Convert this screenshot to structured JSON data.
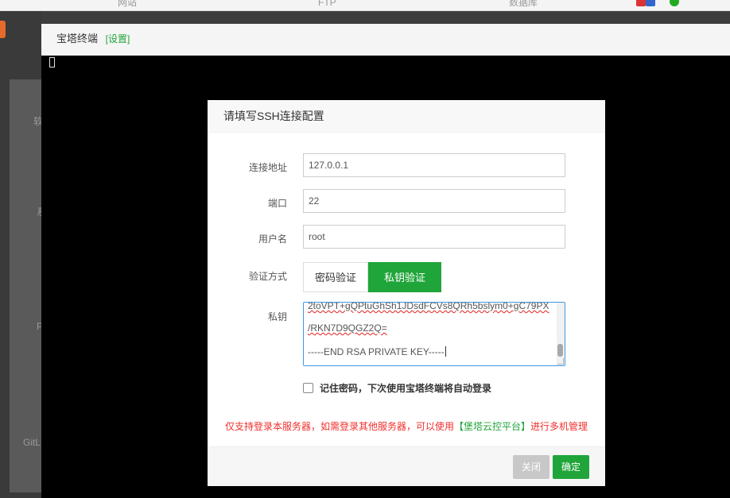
{
  "background": {
    "top_tabs": [
      "网站",
      "FTP",
      "数据库"
    ],
    "side_labels": [
      "软",
      "系",
      "P",
      "GitL"
    ]
  },
  "terminal": {
    "title": "宝塔终端",
    "settings_link": "[设置]"
  },
  "dialog": {
    "title": "请填写SSH连接配置",
    "host_label": "连接地址",
    "host_value": "127.0.0.1",
    "port_label": "端口",
    "port_value": "22",
    "user_label": "用户名",
    "user_value": "root",
    "auth_label": "验证方式",
    "auth_password": "密码验证",
    "auth_key": "私钥验证",
    "key_label": "私钥",
    "key_line1": "2toVPT+gQPtuGhSh1JDsdFCVs8QRh5bslym0+gC79PX",
    "key_line2": "/RKN7D9QGZ2Q=",
    "key_line3": "-----END RSA PRIVATE KEY-----",
    "remember_label": "记住密码，下次使用宝塔终端将自动登录",
    "notice_before": "仅支持登录本服务器，如需登录其他服务器，可以使用",
    "notice_link": "【堡塔云控平台】",
    "notice_after": "进行多机管理",
    "close_button": "关闭",
    "ok_button": "确定"
  },
  "colors": {
    "accent_green": "#20a53a",
    "warning_red": "#f0302d",
    "focus_blue": "#3c99e5"
  }
}
